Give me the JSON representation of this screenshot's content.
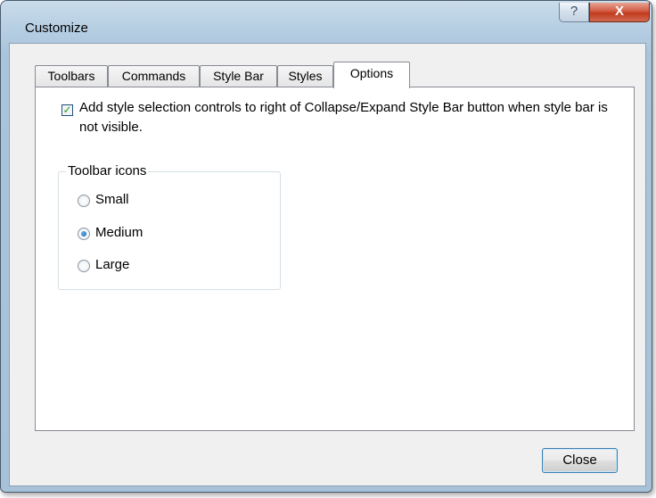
{
  "window": {
    "title": "Customize",
    "help_glyph": "?",
    "close_glyph": "X"
  },
  "tabs": [
    {
      "label": "Toolbars",
      "active": false
    },
    {
      "label": "Commands",
      "active": false
    },
    {
      "label": "Style Bar",
      "active": false
    },
    {
      "label": "Styles",
      "active": false
    },
    {
      "label": "Options",
      "active": true
    }
  ],
  "options": {
    "style_selection": {
      "checked": true,
      "check_glyph": "✓",
      "label": "Add style selection controls to right of Collapse/Expand Style Bar button when style bar is not visible."
    },
    "toolbar_icons": {
      "group_label": "Toolbar icons",
      "options": [
        {
          "label": "Small",
          "selected": false
        },
        {
          "label": "Medium",
          "selected": true
        },
        {
          "label": "Large",
          "selected": false
        }
      ]
    }
  },
  "footer": {
    "close_label": "Close"
  }
}
